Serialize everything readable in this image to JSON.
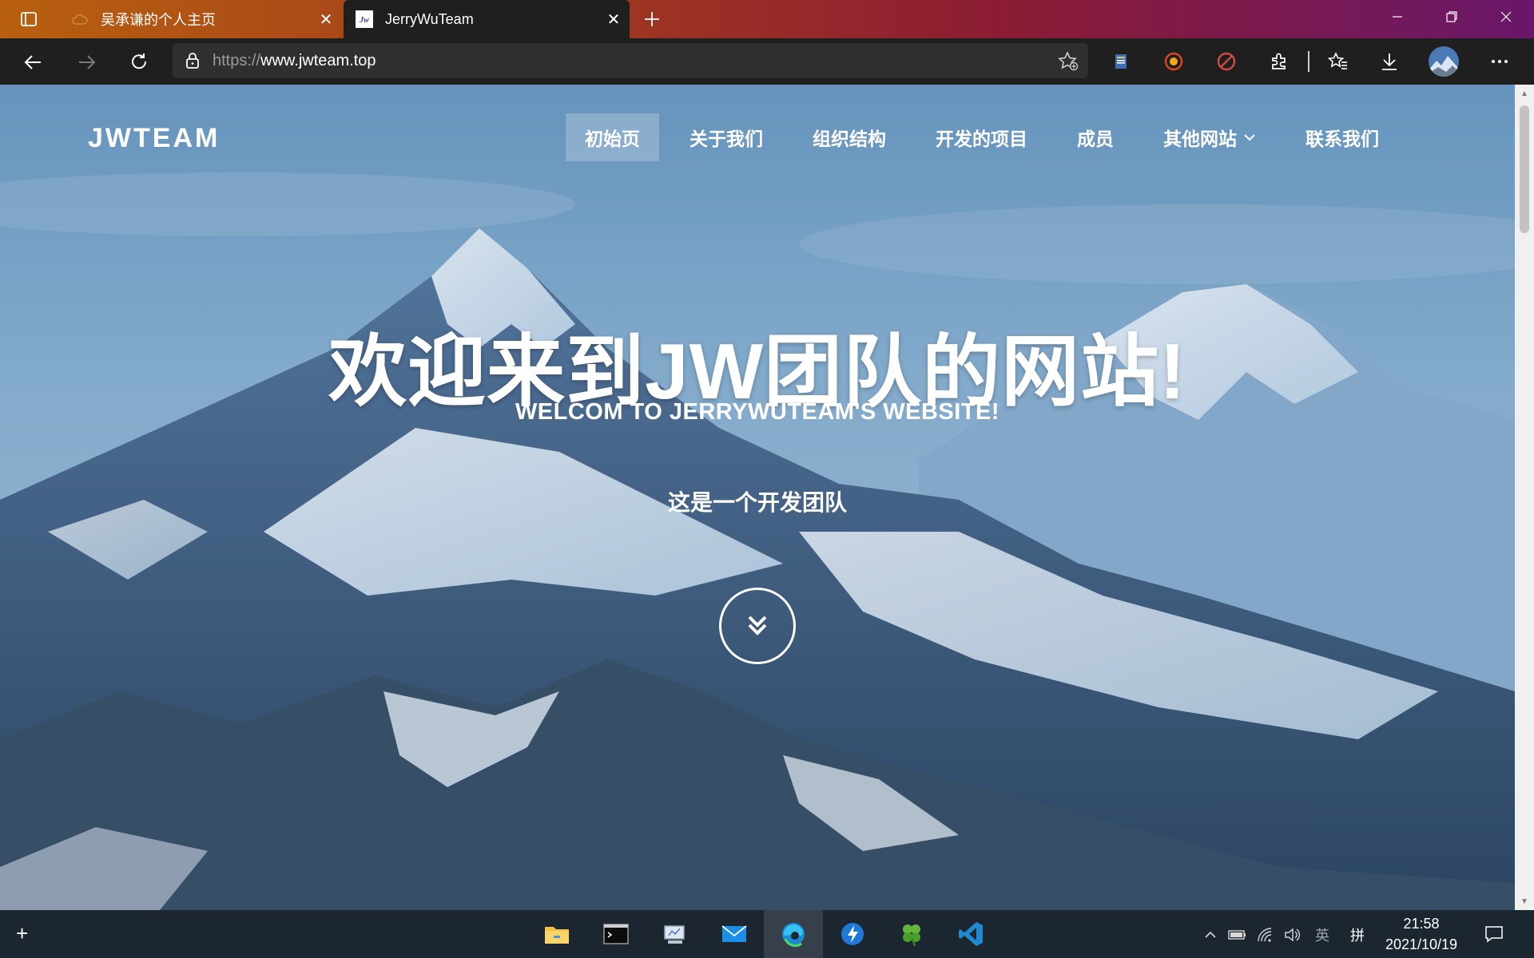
{
  "browser": {
    "tabs": [
      {
        "title": "吴承谦的个人主页",
        "active": false
      },
      {
        "title": "JerryWuTeam",
        "active": true
      }
    ],
    "url_scheme": "https://",
    "url_host": "www.jwteam.top"
  },
  "site": {
    "brand": "JWTEAM",
    "nav": [
      {
        "label": "初始页",
        "active": true
      },
      {
        "label": "关于我们"
      },
      {
        "label": "组织结构"
      },
      {
        "label": "开发的项目"
      },
      {
        "label": "成员"
      },
      {
        "label": "其他网站",
        "dropdown": true
      },
      {
        "label": "联系我们"
      }
    ],
    "hero_title": "欢迎来到JW团队的网站!",
    "hero_subtitle": "WELCOM TO JERRYWUTEAM'S WEBSITE!",
    "hero_tagline": "这是一个开发团队"
  },
  "taskbar": {
    "time": "21:58",
    "date": "2021/10/19",
    "ime_lang": "英",
    "ime_mode": "拼"
  },
  "colors": {
    "sky": "#7fa9cc",
    "mountain_dark": "#34506e",
    "snow": "#e6f0f8",
    "taskbar": "#1c2631"
  }
}
